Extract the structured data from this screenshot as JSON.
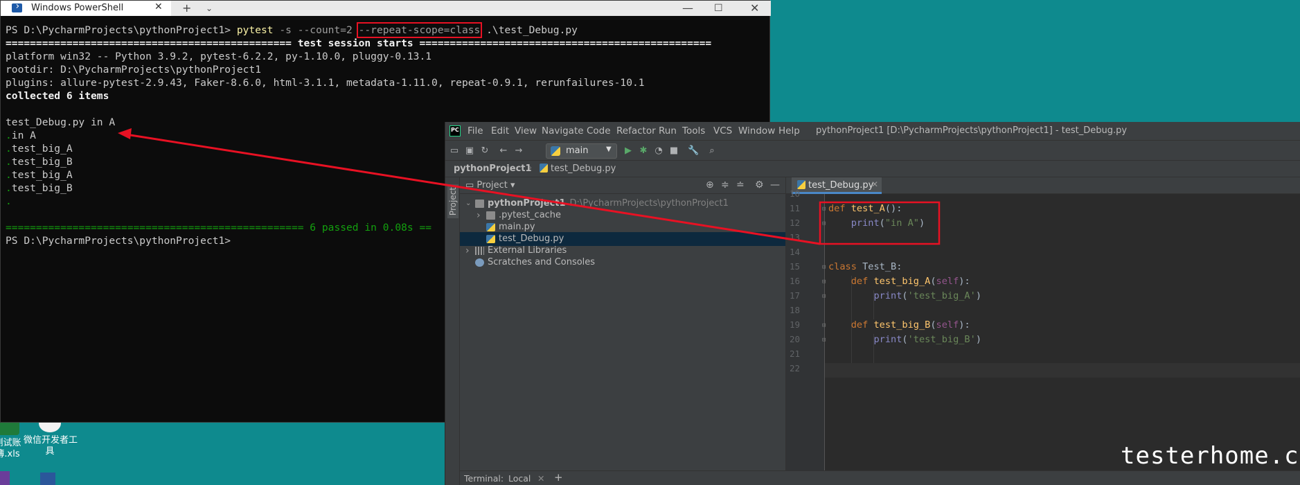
{
  "desktop": {
    "icon1_label": "测试账\n簿.xls",
    "icon2_label": "微信开发者工\n具"
  },
  "powershell": {
    "tab_title": "Windows PowerShell",
    "lines": [
      {
        "parts": [
          {
            "t": "PS D:\\PycharmProjects\\pythonProject1> "
          },
          {
            "t": "pytest",
            "c": "c-yellow"
          },
          {
            "t": " -s --count=2 ",
            "c": "c-gray"
          },
          {
            "t": "--repeat-scope=class",
            "c": "c-gray",
            "box": true
          },
          {
            "t": " .\\test_Debug.py"
          }
        ]
      },
      {
        "parts": [
          {
            "t": "=============================================== ",
            "c": "c-bold"
          },
          {
            "t": "test session starts",
            "c": "c-bold"
          },
          {
            "t": " ================================================",
            "c": "c-bold"
          }
        ]
      },
      {
        "parts": [
          {
            "t": "platform win32 -- Python 3.9.2, pytest-6.2.2, py-1.10.0, pluggy-0.13.1"
          }
        ]
      },
      {
        "parts": [
          {
            "t": "rootdir: D:\\PycharmProjects\\pythonProject1"
          }
        ]
      },
      {
        "parts": [
          {
            "t": "plugins: allure-pytest-2.9.43, Faker-8.6.0, html-3.1.1, metadata-1.11.0, repeat-0.9.1, rerunfailures-10.1"
          }
        ]
      },
      {
        "parts": [
          {
            "t": "collected 6 items",
            "c": "c-bold"
          }
        ]
      },
      {
        "parts": [
          {
            "t": ""
          }
        ]
      },
      {
        "parts": [
          {
            "t": "test_Debug.py in A"
          }
        ]
      },
      {
        "parts": [
          {
            "t": ".",
            "c": "c-green"
          },
          {
            "t": "in A"
          }
        ]
      },
      {
        "parts": [
          {
            "t": ".",
            "c": "c-green"
          },
          {
            "t": "test_big_A"
          }
        ]
      },
      {
        "parts": [
          {
            "t": ".",
            "c": "c-green"
          },
          {
            "t": "test_big_B"
          }
        ]
      },
      {
        "parts": [
          {
            "t": ".",
            "c": "c-green"
          },
          {
            "t": "test_big_A"
          }
        ]
      },
      {
        "parts": [
          {
            "t": ".",
            "c": "c-green"
          },
          {
            "t": "test_big_B"
          }
        ]
      },
      {
        "parts": [
          {
            "t": ".",
            "c": "c-green"
          }
        ]
      },
      {
        "parts": [
          {
            "t": ""
          }
        ]
      },
      {
        "parts": [
          {
            "t": "================================================= 6 passed in 0.08s ==",
            "c": "c-green"
          }
        ]
      },
      {
        "parts": [
          {
            "t": "PS D:\\PycharmProjects\\pythonProject1> "
          }
        ]
      }
    ]
  },
  "pycharm": {
    "menu": [
      "File",
      "Edit",
      "View",
      "Navigate",
      "Code",
      "Refactor",
      "Run",
      "Tools",
      "VCS",
      "Window",
      "Help"
    ],
    "title": "pythonProject1 [D:\\PycharmProjects\\pythonProject1] - test_Debug.py",
    "run_config": "main",
    "nav_project": "pythonProject1",
    "nav_file": "test_Debug.py",
    "side_tab": "Project",
    "project_panel_label": "Project",
    "tree": [
      {
        "label": "pythonProject1",
        "extra": "D:\\PycharmProjects\\pythonProject1",
        "level": 0,
        "twisty": "open",
        "icon": "folder",
        "bold": true
      },
      {
        "label": ".pytest_cache",
        "level": 1,
        "twisty": "closed",
        "icon": "folder"
      },
      {
        "label": "main.py",
        "level": 1,
        "twisty": "none",
        "icon": "py"
      },
      {
        "label": "test_Debug.py",
        "level": 1,
        "twisty": "none",
        "icon": "py",
        "selected": true
      },
      {
        "label": "External Libraries",
        "level": 0,
        "twisty": "closed",
        "icon": "libs"
      },
      {
        "label": "Scratches and Consoles",
        "level": 0,
        "twisty": "none",
        "icon": "scratch"
      }
    ],
    "editor_tab": "test_Debug.py",
    "line_numbers": [
      "10",
      "11",
      "12",
      "13",
      "14",
      "15",
      "16",
      "17",
      "18",
      "19",
      "20",
      "21",
      "22"
    ],
    "code": [
      [],
      [
        {
          "t": "def ",
          "c": "kw"
        },
        {
          "t": "test_A",
          "c": "fn"
        },
        {
          "t": "():"
        }
      ],
      [
        {
          "t": "    "
        },
        {
          "t": "print",
          "c": "bi"
        },
        {
          "t": "("
        },
        {
          "t": "\"in A\"",
          "c": "str"
        },
        {
          "t": ")"
        }
      ],
      [],
      [],
      [
        {
          "t": "class ",
          "c": "kw"
        },
        {
          "t": "Test_B:"
        }
      ],
      [
        {
          "t": "    "
        },
        {
          "t": "def ",
          "c": "kw"
        },
        {
          "t": "test_big_A",
          "c": "fn"
        },
        {
          "t": "("
        },
        {
          "t": "self",
          "c": "slf"
        },
        {
          "t": "):"
        }
      ],
      [
        {
          "t": "        "
        },
        {
          "t": "print",
          "c": "bi"
        },
        {
          "t": "("
        },
        {
          "t": "'test_big_A'",
          "c": "str"
        },
        {
          "t": ")"
        }
      ],
      [],
      [
        {
          "t": "    "
        },
        {
          "t": "def ",
          "c": "kw"
        },
        {
          "t": "test_big_B",
          "c": "fn"
        },
        {
          "t": "("
        },
        {
          "t": "self",
          "c": "slf"
        },
        {
          "t": "):"
        }
      ],
      [
        {
          "t": "        "
        },
        {
          "t": "print",
          "c": "bi"
        },
        {
          "t": "("
        },
        {
          "t": "'test_big_B'",
          "c": "str"
        },
        {
          "t": ")"
        }
      ],
      [],
      []
    ],
    "bottom_terminal": "Terminal:",
    "bottom_local": "Local"
  },
  "watermark": "testerhome.com",
  "colors": {
    "annotation_red": "#e81123",
    "desktop_teal": "#0e8a8e",
    "terminal_bg": "#0c0c0c",
    "ide_bg": "#2b2b2b"
  }
}
